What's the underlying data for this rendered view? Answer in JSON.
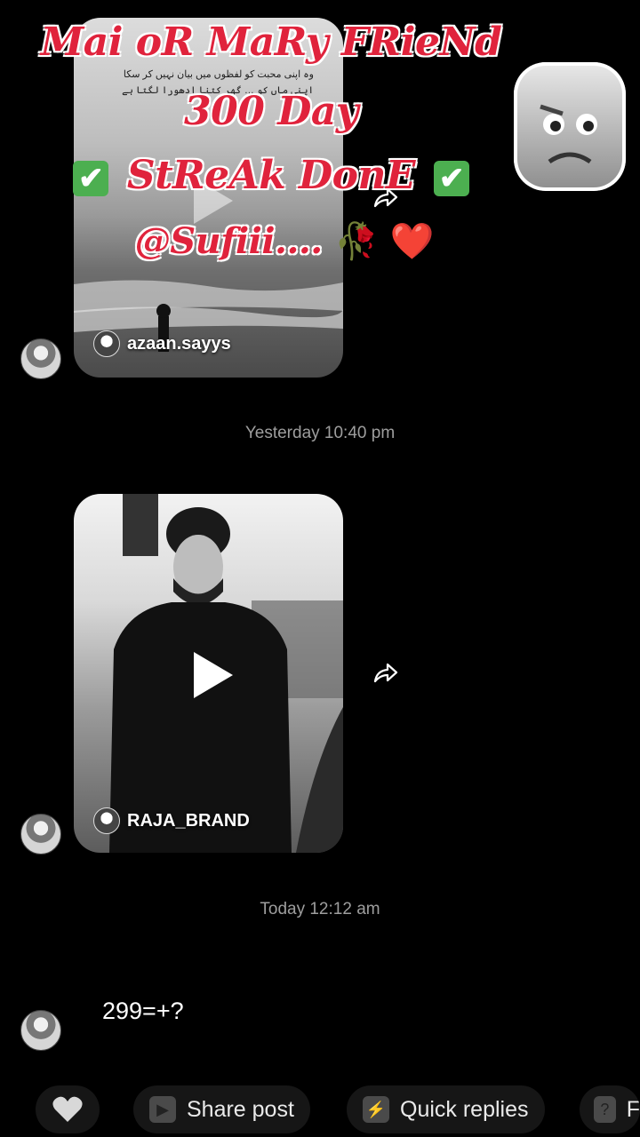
{
  "overlay": {
    "line1": "Mai oR MaRy FRieNd",
    "line2": "300 Day",
    "line3": "StReAk DonE",
    "line4": "@Sufiii....",
    "check_glyph": "✔",
    "heart_emoji": "❤️",
    "rose_emoji": "🥀"
  },
  "messages": [
    {
      "type": "video",
      "username": "azaan.sayys",
      "caption_lines": [
        "وہ اپنی محبت کو لفظوں میں بیان نہیں کر سکا",
        "اپنی ماں کو … گھر کتنا ادھورا لگتا ہے"
      ]
    },
    {
      "type": "timestamp",
      "text": "Yesterday 10:40 pm"
    },
    {
      "type": "video",
      "username": "RAJA_BRAND"
    },
    {
      "type": "timestamp",
      "text": "Today 12:12 am"
    },
    {
      "type": "text",
      "text": "299=+?"
    }
  ],
  "bottom_bar": {
    "like_icon": "heart-icon",
    "share_post": "Share post",
    "quick_replies": "Quick replies",
    "truncated_label": "F"
  },
  "colors": {
    "overlay_red": "#e0233c",
    "background": "#000000",
    "timestamp": "#9e9e9e"
  }
}
